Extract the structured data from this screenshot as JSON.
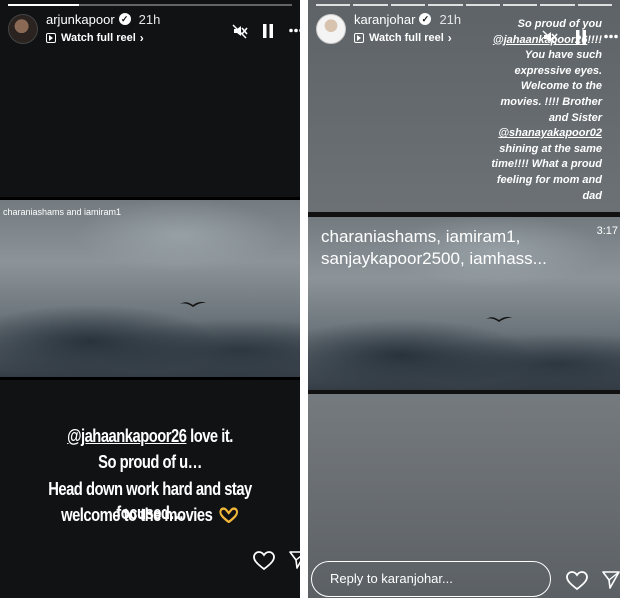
{
  "left": {
    "username": "arjunkapoor",
    "time": "21h",
    "watch_label": "Watch full reel",
    "chevron": "›",
    "sky_caption": "charaniashams and iamiram1",
    "caption": {
      "mention": "@jahaankapoor26",
      "line1_rest": " love it.",
      "line2": "So proud of u…",
      "line3": "Head down work hard and stay focused…",
      "line4": "welcome to the movies",
      "emoji_name": "heart-hands"
    },
    "icons": [
      "mute-icon",
      "pause-icon",
      "more-icon",
      "heart-icon",
      "send-icon"
    ],
    "progress_fraction": 0.25
  },
  "right": {
    "username": "karanjohar",
    "time": "21h",
    "watch_label": "Watch full reel",
    "chevron": "›",
    "caption_lines": [
      {
        "pre": "So proud of you",
        "mention": ""
      },
      {
        "pre": "",
        "mention": "@jahaankapoor26",
        "post": "!!!!"
      },
      {
        "pre": "You have such",
        "mention": ""
      },
      {
        "pre": "expressive eyes.",
        "mention": ""
      },
      {
        "pre": "Welcome to the",
        "mention": ""
      },
      {
        "pre": "movies.  !!!! Brother",
        "mention": ""
      },
      {
        "pre": "and Sister",
        "mention": ""
      },
      {
        "pre": "",
        "mention": "@shanayakapoor02",
        "post": ""
      },
      {
        "pre": "shining  at  the same",
        "mention": ""
      },
      {
        "pre": "time!!!! What a proud",
        "mention": ""
      },
      {
        "pre": "feeling for mom and",
        "mention": ""
      },
      {
        "pre": "dad",
        "mention": ""
      }
    ],
    "reel_caption_line1": "charaniashams, iamiram1,",
    "reel_caption_line2": "sanjaykapoor2500, iamhass...",
    "reel_time": "3:17",
    "reply_placeholder": "Reply to karanjohar...",
    "icons": [
      "mute-icon",
      "pause-icon",
      "more-icon",
      "heart-icon",
      "send-icon"
    ],
    "progress_segments": 8
  },
  "colors": {
    "left_bg": "#111214",
    "right_bg": "#6e7377",
    "text": "#ffffff"
  }
}
